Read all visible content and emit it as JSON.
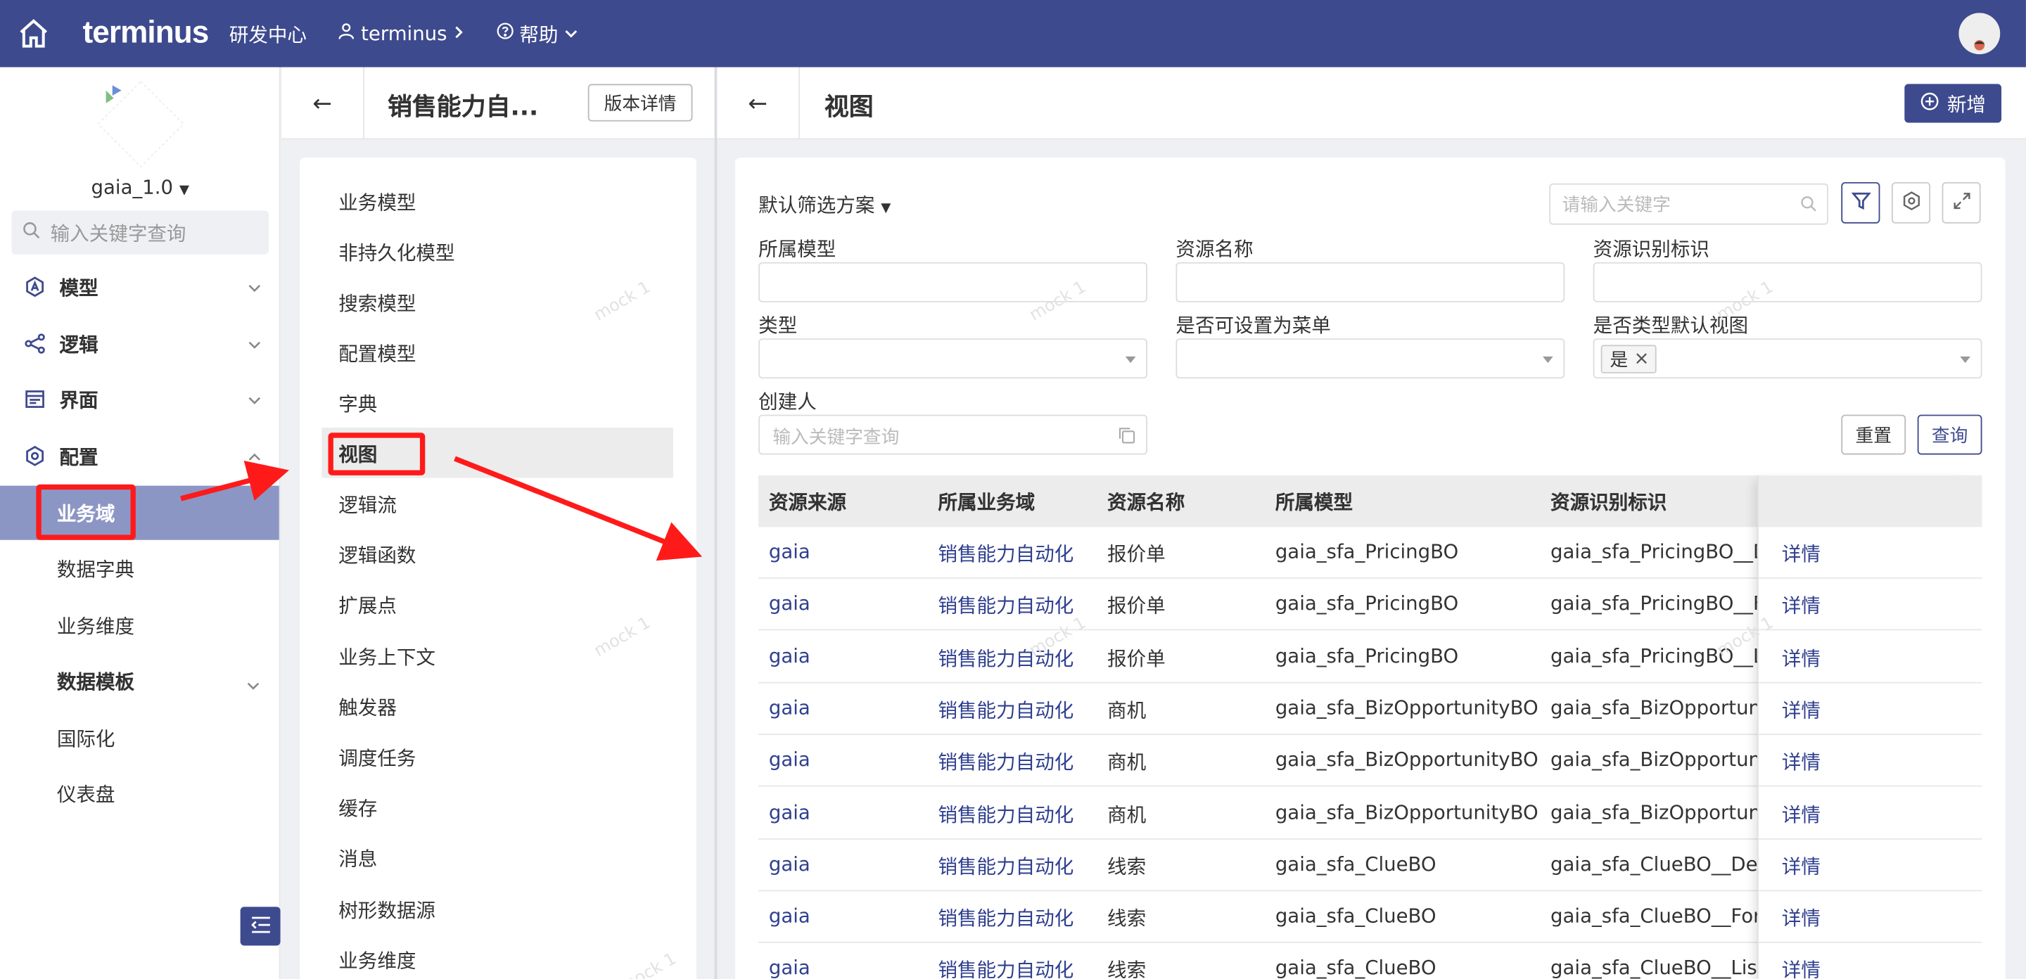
{
  "topbar": {
    "brand": "terminus",
    "section": "研发中心",
    "org": "terminus",
    "help": "帮助"
  },
  "sidebar": {
    "app_name": "gaia_1.0",
    "search_placeholder": "输入关键字查询",
    "groups": {
      "model": "模型",
      "logic": "逻辑",
      "ui": "界面",
      "config": "配置"
    },
    "items": {
      "business_domain": "业务域",
      "data_dictionary": "数据字典",
      "business_dimension": "业务维度",
      "data_template": "数据模板",
      "i18n": "国际化",
      "dashboard": "仪表盘"
    }
  },
  "middle": {
    "title": "销售能力自...",
    "version_button": "版本详情",
    "menu": [
      "业务模型",
      "非持久化模型",
      "搜索模型",
      "配置模型",
      "字典",
      "视图",
      "逻辑流",
      "逻辑函数",
      "扩展点",
      "业务上下文",
      "触发器",
      "调度任务",
      "缓存",
      "消息",
      "树形数据源",
      "业务维度"
    ],
    "selected_index": 5
  },
  "right": {
    "title": "视图",
    "new_button": "新增",
    "filter_scheme": "默认筛选方案",
    "keyword_placeholder": "请输入关键字",
    "filters": {
      "model_label": "所属模型",
      "resource_name_label": "资源名称",
      "resource_key_label": "资源识别标识",
      "type_label": "类型",
      "menu_label": "是否可设置为菜单",
      "default_view_label": "是否类型默认视图",
      "default_view_tag": "是",
      "creator_label": "创建人",
      "creator_placeholder": "输入关键字查询"
    },
    "reset_button": "重置",
    "query_button": "查询",
    "table": {
      "columns": [
        "资源来源",
        "所属业务域",
        "资源名称",
        "所属模型",
        "资源识别标识",
        ""
      ],
      "rows": [
        [
          "gaia",
          "销售能力自动化",
          "报价单",
          "gaia_sfa_PricingBO",
          "gaia_sfa_PricingBO__D",
          "详情"
        ],
        [
          "gaia",
          "销售能力自动化",
          "报价单",
          "gaia_sfa_PricingBO",
          "gaia_sfa_PricingBO__F",
          "详情"
        ],
        [
          "gaia",
          "销售能力自动化",
          "报价单",
          "gaia_sfa_PricingBO",
          "gaia_sfa_PricingBO__L",
          "详情"
        ],
        [
          "gaia",
          "销售能力自动化",
          "商机",
          "gaia_sfa_BizOpportunityBO",
          "gaia_sfa_BizOpportuni",
          "详情"
        ],
        [
          "gaia",
          "销售能力自动化",
          "商机",
          "gaia_sfa_BizOpportunityBO",
          "gaia_sfa_BizOpportuni",
          "详情"
        ],
        [
          "gaia",
          "销售能力自动化",
          "商机",
          "gaia_sfa_BizOpportunityBO",
          "gaia_sfa_BizOpportuni",
          "详情"
        ],
        [
          "gaia",
          "销售能力自动化",
          "线索",
          "gaia_sfa_ClueBO",
          "gaia_sfa_ClueBO__Det",
          "详情"
        ],
        [
          "gaia",
          "销售能力自动化",
          "线索",
          "gaia_sfa_ClueBO",
          "gaia_sfa_ClueBO__For",
          "详情"
        ],
        [
          "gaia",
          "销售能力自动化",
          "线索",
          "gaia_sfa_ClueBO",
          "gaia_sfa_ClueBO__List",
          "详情"
        ]
      ]
    }
  },
  "watermark": "mock 1",
  "colors": {
    "brand": "#3e4a8e",
    "active_sidebar": "#8c96c5",
    "annotation": "#ff1a1a",
    "link": "#2f3f8f"
  }
}
